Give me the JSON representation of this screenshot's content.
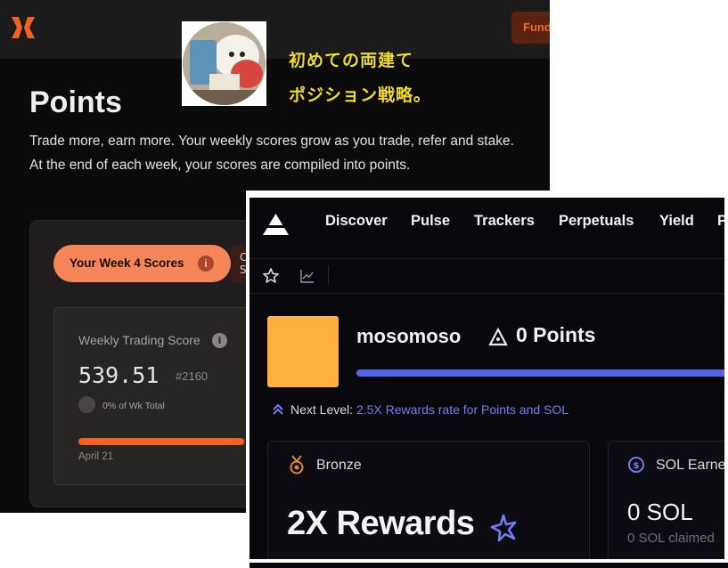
{
  "points_page": {
    "fund_button": "Fund",
    "title": "Points",
    "description_line1": "Trade more, earn more. Your weekly scores grow as you trade, refer and stake.",
    "description_line2": "At the end of each week, your scores are compiled into points.",
    "week_tab": "Your Week 4 Scores",
    "week_tab_info": "i",
    "second_tab": "C S",
    "score_card": {
      "label": "Weekly Trading Score",
      "info": "i",
      "value": "539.51",
      "rank": "#2160",
      "share": "0% of Wk Total",
      "progress_fraction": 0.98,
      "date": "April 21"
    },
    "accent_color": "#f06224"
  },
  "caption": {
    "line1": "初めての両建て",
    "line2": "ポジション戦略。",
    "color": "#f2dc2a"
  },
  "axiom": {
    "nav": [
      "Discover",
      "Pulse",
      "Trackers",
      "Perpetuals",
      "Yield",
      "P"
    ],
    "icons": [
      "star-icon",
      "chart-icon"
    ],
    "username": "mosomoso",
    "points": "0 Points",
    "next_level_prefix": "Next Level:",
    "next_level_value": "2.5X Rewards rate for Points and SOL",
    "tier": "Bronze",
    "rewards": "2X Rewards",
    "sol_label": "SOL Earned",
    "sol_value": "0 SOL",
    "sol_claimed": "0 SOL claimed",
    "accent_color": "#5563e8",
    "avatar_color": "#ffb13e"
  }
}
